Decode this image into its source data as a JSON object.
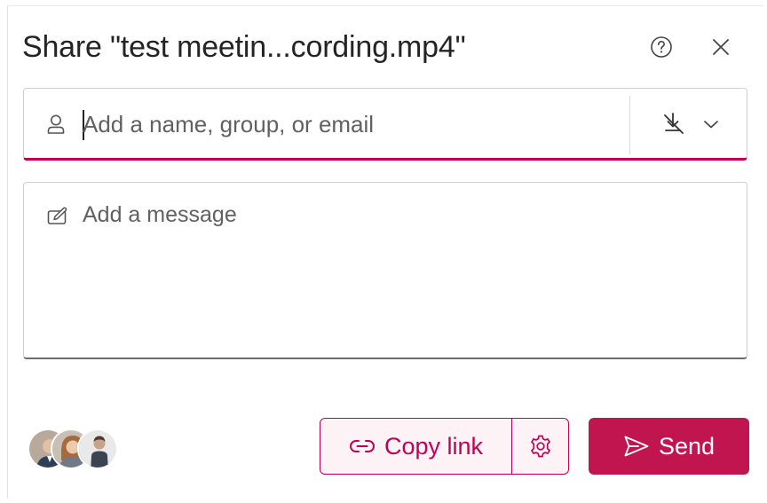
{
  "dialog": {
    "title": "Share \"test meetin...cording.mp4\"",
    "help_icon": "help-circle-icon",
    "close_icon": "close-icon"
  },
  "recipients": {
    "placeholder": "Add a name, group, or email",
    "value": "",
    "icon": "person-icon",
    "permission_icon": "no-download-icon",
    "dropdown_icon": "chevron-down-icon"
  },
  "message": {
    "placeholder": "Add a message",
    "value": "",
    "icon": "edit-icon"
  },
  "shared_with": {
    "avatars": [
      "avatar-1",
      "avatar-2",
      "avatar-3"
    ]
  },
  "actions": {
    "copy_link_label": "Copy link",
    "copy_link_icon": "link-icon",
    "settings_icon": "gear-icon",
    "send_label": "Send",
    "send_icon": "send-icon"
  },
  "colors": {
    "accent": "#c30052",
    "send_bg": "#c0154f",
    "copy_bg": "#fdf3f6",
    "text": "#242424",
    "placeholder": "#616161"
  }
}
